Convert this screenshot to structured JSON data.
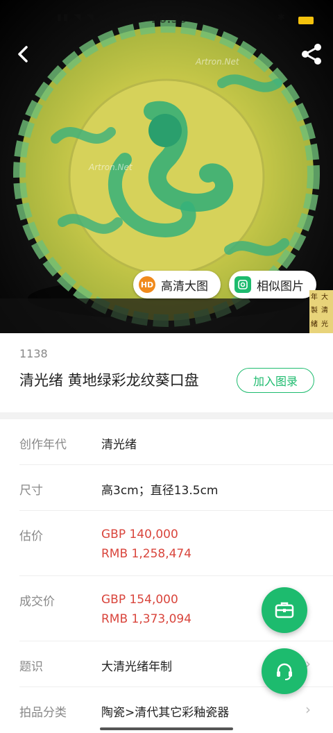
{
  "status": {
    "time": "20:36"
  },
  "hero": {
    "watermark": "Artron.Net",
    "hd_badge": "HD",
    "hd_label": "高清大图",
    "similar_label": "相似图片",
    "seal_chars": [
      "大",
      "清",
      "光",
      "緒",
      "年",
      "製"
    ]
  },
  "lot": {
    "number": "1138",
    "title": "清光绪 黄地绿彩龙纹葵口盘",
    "add_button": "加入图录"
  },
  "details": [
    {
      "label": "创作年代",
      "value": "清光绪"
    },
    {
      "label": "尺寸",
      "value": "高3cm；直径13.5cm"
    },
    {
      "label": "估价",
      "value_gbp": "GBP  140,000",
      "value_rmb": "RMB 1,258,474"
    },
    {
      "label": "成交价",
      "value_gbp": "GBP  154,000",
      "value_rmb": "RMB 1,373,094"
    },
    {
      "label": "题识",
      "value": "大清光绪年制"
    },
    {
      "label": "拍品分类",
      "value": "陶瓷>清代其它彩釉瓷器"
    }
  ],
  "colors": {
    "accent": "#1dbb6e",
    "price": "#d9453c",
    "hd_badge": "#f08a1c"
  },
  "icons": [
    "back-icon",
    "share-icon",
    "hd-icon",
    "similar-image-icon",
    "chevron-right-icon",
    "briefcase-icon",
    "headset-icon"
  ]
}
